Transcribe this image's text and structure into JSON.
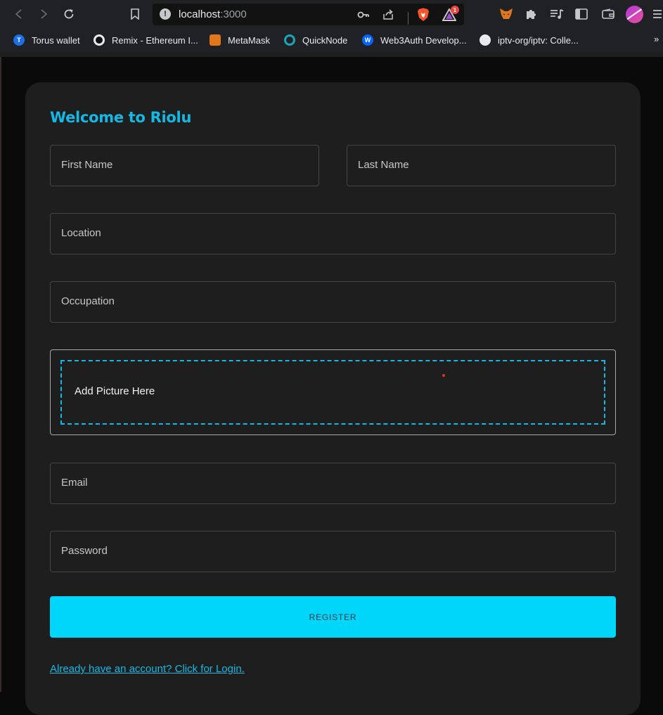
{
  "browser": {
    "url_host": "localhost",
    "url_port": ":3000",
    "alerts_badge_count": "1",
    "bookmarks": [
      {
        "label": "Torus wallet",
        "icon": "torus-icon",
        "color": "#1d6fe6",
        "glyph": "T"
      },
      {
        "label": "Remix - Ethereum I...",
        "icon": "remix-icon",
        "color": "#2a2a2a",
        "glyph": "◉"
      },
      {
        "label": "MetaMask",
        "icon": "metamask-fox-icon",
        "color": "#e2761b",
        "glyph": "▲"
      },
      {
        "label": "QuickNode",
        "icon": "quicknode-icon",
        "color": "#1aa6b7",
        "glyph": "Q"
      },
      {
        "label": "Web3Auth Develop...",
        "icon": "web3auth-icon",
        "color": "#0364ff",
        "glyph": "W"
      },
      {
        "label": "iptv-org/iptv: Colle...",
        "icon": "github-icon",
        "color": "#e8eaed",
        "glyph": "●"
      }
    ],
    "more_bookmarks": "»"
  },
  "form": {
    "title": "Welcome to Riolu",
    "first_name_label": "First Name",
    "last_name_label": "Last Name",
    "location_label": "Location",
    "occupation_label": "Occupation",
    "picture_label": "Add Picture Here",
    "email_label": "Email",
    "password_label": "Password",
    "register_label": "REGISTER",
    "login_link": "Already have an account? Click for Login."
  },
  "colors": {
    "accent": "#00d5fa",
    "title": "#14b8e4",
    "card_bg": "#1e1e1e",
    "page_bg": "#0a0a0a"
  }
}
